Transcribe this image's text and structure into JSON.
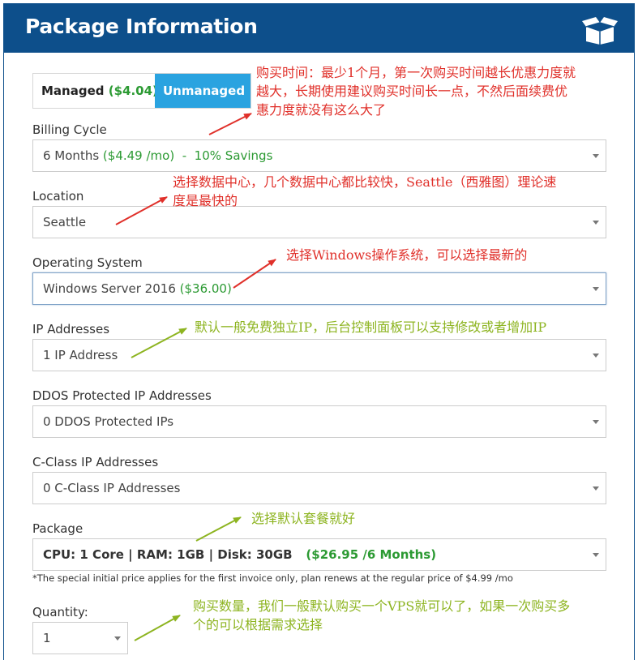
{
  "header": {
    "title": "Package Information",
    "icon": "open-box-icon"
  },
  "management": {
    "managed_label": "Managed",
    "managed_price": "($4.04)",
    "unmanaged_label": "Unmanaged",
    "selected": "Unmanaged"
  },
  "billing_cycle": {
    "label": "Billing Cycle",
    "value_term": "6 Months",
    "value_price": "($4.49 /mo)",
    "value_savings": " -  10% Savings"
  },
  "location": {
    "label": "Location",
    "value": "Seattle"
  },
  "operating_system": {
    "label": "Operating System",
    "value_name": "Windows Server 2016",
    "value_price": "($36.00)"
  },
  "ip_addresses": {
    "label": "IP Addresses",
    "value": "1 IP Address"
  },
  "ddos_ips": {
    "label": "DDOS Protected IP Addresses",
    "value": "0 DDOS Protected IPs"
  },
  "cclass_ips": {
    "label": "C-Class IP Addresses",
    "value": "0 C-Class IP Addresses"
  },
  "package": {
    "label": "Package",
    "value_spec": "CPU: 1 Core | RAM: 1GB | Disk: 30GB",
    "value_price": "($26.95 /6 Months)",
    "note": "*The special initial price applies for the first invoice only, plan renews at the regular price of $4.99 /mo"
  },
  "quantity": {
    "label": "Quantity:",
    "value": "1"
  },
  "annotations": {
    "billing_1": "购买时间：最少1个月，第一次购买时间越长优惠力度就",
    "billing_2": "越大，长期使用建议购买时间长一点，不然后面续费优",
    "billing_3": "惠力度就没有这么大了",
    "location_1": "选择数据中心，几个数据中心都比较快，Seattle（西雅图）理论速",
    "location_2": "度是最快的",
    "os": "选择Windows操作系统，可以选择最新的",
    "ip": "默认一般免费独立IP，后台控制面板可以支持修改或者增加IP",
    "package": "选择默认套餐就好",
    "quantity_1": "购买数量，我们一般默认购买一个VPS就可以了，如果一次购买多",
    "quantity_2": "个的可以根据需求选择"
  },
  "colors": {
    "header_bg": "#0d4f8b",
    "toggle_active": "#2aa3e0",
    "price_green": "#2c9a33",
    "annotation_red": "#e0302a",
    "annotation_lime": "#8db420"
  }
}
